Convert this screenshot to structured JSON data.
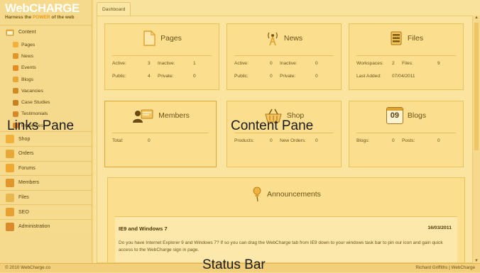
{
  "logo": {
    "web": "Web",
    "charge": "CHARGE",
    "tag_pre": "Harness the ",
    "tag_power": "POWER",
    "tag_post": " of the web"
  },
  "sidebar": {
    "content_label": "Content",
    "content_items": [
      {
        "label": "Pages",
        "icon": "page-icon",
        "color": "#f2b13a"
      },
      {
        "label": "News",
        "icon": "news-icon",
        "color": "#e0962b"
      },
      {
        "label": "Events",
        "icon": "clock-icon",
        "color": "#e58b24"
      },
      {
        "label": "Blogs",
        "icon": "blog-icon",
        "color": "#e8a836"
      },
      {
        "label": "Vacancies",
        "icon": "person-icon",
        "color": "#cf8a24"
      },
      {
        "label": "Case Studies",
        "icon": "building-icon",
        "color": "#c68026"
      },
      {
        "label": "Testimonials",
        "icon": "person-icon",
        "color": "#d48a2a"
      },
      {
        "label": "Properties",
        "icon": "house-icon",
        "color": "#d98a2a"
      }
    ],
    "sections": [
      {
        "label": "Shop",
        "icon": "shop-icon"
      },
      {
        "label": "Orders",
        "icon": "orders-icon"
      },
      {
        "label": "Forums",
        "icon": "forums-icon"
      },
      {
        "label": "Members",
        "icon": "members-icon"
      },
      {
        "label": "Files",
        "icon": "files-icon"
      },
      {
        "label": "SEO",
        "icon": "seo-icon"
      },
      {
        "label": "Administration",
        "icon": "admin-icon"
      }
    ]
  },
  "tab": {
    "label": "Dashboard"
  },
  "cards": {
    "pages": {
      "title": "Pages",
      "r1": {
        "k1": "Active:",
        "v1": "3",
        "k2": "Inactive:",
        "v2": "1"
      },
      "r2": {
        "k1": "Public:",
        "v1": "4",
        "k2": "Private:",
        "v2": "0"
      }
    },
    "news": {
      "title": "News",
      "r1": {
        "k1": "Active:",
        "v1": "0",
        "k2": "Inactive:",
        "v2": "0"
      },
      "r2": {
        "k1": "Public:",
        "v1": "0",
        "k2": "Private:",
        "v2": "0"
      }
    },
    "files": {
      "title": "Files",
      "r1": {
        "k1": "Workspaces:",
        "v1": "2",
        "k2": "Files:",
        "v2": "9"
      },
      "r2": {
        "k1": "Last Added:",
        "v1": "07/04/2011"
      }
    },
    "members": {
      "title": "Members",
      "r1": {
        "k1": "Total:",
        "v1": "0"
      }
    },
    "shop": {
      "title": "Shop",
      "r1": {
        "k1": "Products:",
        "v1": "0",
        "k2": "New Orders:",
        "v2": "0"
      }
    },
    "blogs": {
      "title": "Blogs",
      "calendar_day": "09",
      "r1": {
        "k1": "Blogs:",
        "v1": "0",
        "k2": "Posts:",
        "v2": "0"
      }
    }
  },
  "announcements": {
    "title": "Announcements",
    "item": {
      "title": "IE9 and Windows 7",
      "date": "16/03/2011",
      "body": "Do you have Internet Explorer 9 and Windows 7? If so you can drag the WebCharge tab from IE9 down to your windows task bar to pin our icon and gain quick access to the WebCharge sign in page."
    }
  },
  "status": {
    "left": "© 2010 WebCharge.co",
    "right": "Richard Griffiths | WebCharge"
  },
  "overlays": {
    "links": "Links Pane",
    "content": "Content Pane",
    "status": "Status Bar"
  },
  "colors": {
    "accent": "#f0b23c",
    "panel": "#fbe4a0",
    "border": "#eac25c"
  }
}
